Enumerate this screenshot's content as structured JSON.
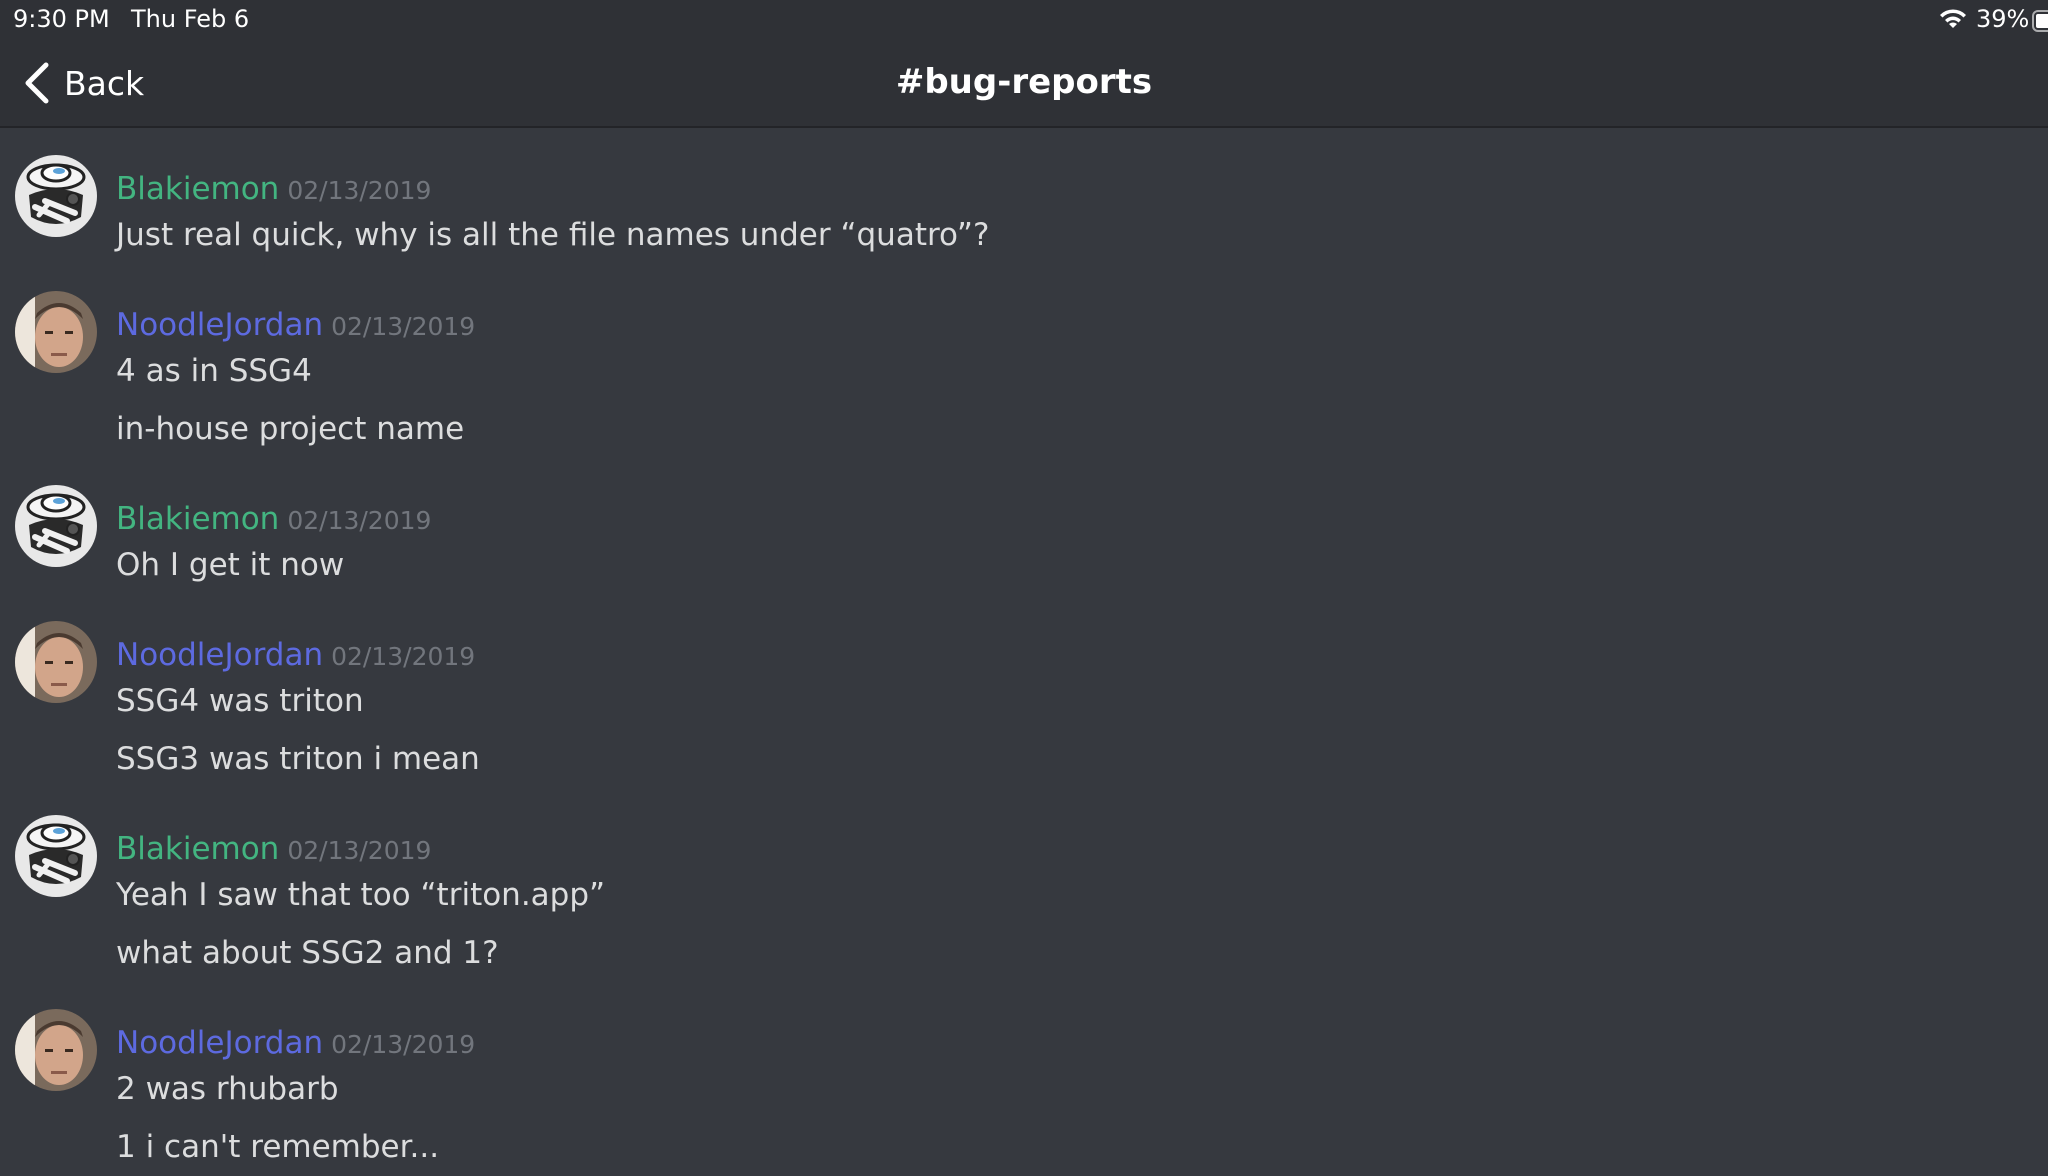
{
  "status_bar": {
    "time": "9:30 PM",
    "date": "Thu Feb 6",
    "battery_percent": "39%"
  },
  "nav": {
    "back_label": "Back",
    "channel_title": "#bug-reports"
  },
  "colors": {
    "background": "#36393f",
    "header": "#2f3136",
    "user_green": "#43b581",
    "user_blue": "#5d6ae0",
    "timestamp": "#72767d",
    "text": "#dcddde"
  },
  "messages": [
    {
      "username": "Blakiemon",
      "timestamp": "02/13/2019",
      "lines": [
        "Just real quick, why is all the file names under “quatro”?"
      ]
    },
    {
      "username": "NoodleJordan",
      "timestamp": "02/13/2019",
      "lines": [
        "4 as in SSG4",
        "in-house project name"
      ]
    },
    {
      "username": "Blakiemon",
      "timestamp": "02/13/2019",
      "lines": [
        "Oh I get it now"
      ]
    },
    {
      "username": "NoodleJordan",
      "timestamp": "02/13/2019",
      "lines": [
        "SSG4 was triton",
        "SSG3 was triton i mean"
      ]
    },
    {
      "username": "Blakiemon",
      "timestamp": "02/13/2019",
      "lines": [
        "Yeah I saw that too “triton.app”",
        "what about SSG2 and 1?"
      ]
    },
    {
      "username": "NoodleJordan",
      "timestamp": "02/13/2019",
      "lines": [
        "2 was rhubarb",
        "1 i can't remember..."
      ]
    }
  ]
}
